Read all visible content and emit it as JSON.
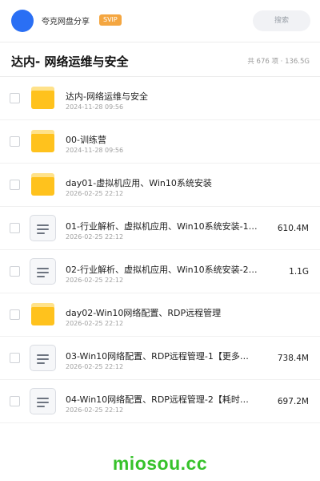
{
  "header": {
    "user_name": "夸克网盘分享",
    "badge": "SVIP",
    "search_placeholder": "搜索",
    "avatar_color": "#2a6ff4"
  },
  "folder": {
    "title": "达内- 网络运维与安全",
    "meta": "共 676 项 · 136.5G"
  },
  "items": [
    {
      "type": "folder",
      "name": "达内-网络运维与安全",
      "date": "2024-11-28 09:56",
      "size": ""
    },
    {
      "type": "folder",
      "name": "00-训练营",
      "date": "2024-11-28 09:56",
      "size": ""
    },
    {
      "type": "folder",
      "name": "day01-虚拟机应用、Win10系统安装",
      "date": "2026-02-25 22:12",
      "size": ""
    },
    {
      "type": "file",
      "name": "01-行业解析、虚拟机应用、Win10系统安装-1…",
      "date": "2026-02-25 22:12",
      "size": "610.4M"
    },
    {
      "type": "file",
      "name": "02-行业解析、虚拟机应用、Win10系统安装-2…",
      "date": "2026-02-25 22:12",
      "size": "1.1G"
    },
    {
      "type": "folder",
      "name": "day02-Win10网络配置、RDP远程管理",
      "date": "2026-02-25 22:12",
      "size": ""
    },
    {
      "type": "file",
      "name": "03-Win10网络配置、RDP远程管理-1【更多…",
      "date": "2026-02-25 22:12",
      "size": "738.4M"
    },
    {
      "type": "file",
      "name": "04-Win10网络配置、RDP远程管理-2【耗时…",
      "date": "2026-02-25 22:12",
      "size": "697.2M"
    }
  ],
  "watermark": "miosou.cc",
  "colors": {
    "folder": "#ffc21d",
    "badge": "#f4a640",
    "watermark": "#36c22a"
  }
}
